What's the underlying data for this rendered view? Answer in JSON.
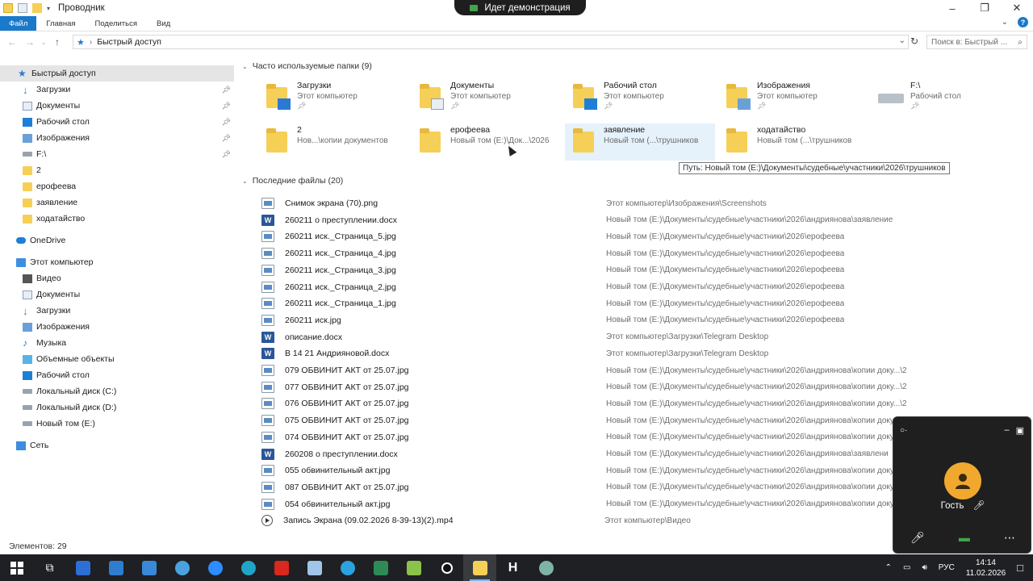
{
  "window": {
    "title": "Проводник",
    "demo_banner": "Идет демонстрация"
  },
  "ribbon": {
    "tabs": [
      "Файл",
      "Главная",
      "Поделиться",
      "Вид"
    ]
  },
  "address": {
    "path": "Быстрый доступ",
    "search_placeholder": "Поиск в: Быстрый ..."
  },
  "sidebar": {
    "quick_access": "Быстрый доступ",
    "pinned": [
      {
        "label": "Загрузки",
        "icon": "download-icon",
        "pinned": true
      },
      {
        "label": "Документы",
        "icon": "documents-icon",
        "pinned": true
      },
      {
        "label": "Рабочий стол",
        "icon": "desktop-icon",
        "pinned": true
      },
      {
        "label": "Изображения",
        "icon": "pictures-icon",
        "pinned": true
      },
      {
        "label": "F:\\",
        "icon": "drive-icon",
        "pinned": true
      },
      {
        "label": "2",
        "icon": "folder-icon",
        "pinned": false
      },
      {
        "label": "ерофеева",
        "icon": "folder-icon",
        "pinned": false
      },
      {
        "label": "заявление",
        "icon": "folder-icon",
        "pinned": false
      },
      {
        "label": "ходатайство",
        "icon": "folder-icon",
        "pinned": false
      }
    ],
    "onedrive": "OneDrive",
    "this_pc": "Этот компьютер",
    "pc_items": [
      {
        "label": "Видео",
        "icon": "video-icon"
      },
      {
        "label": "Документы",
        "icon": "documents-icon"
      },
      {
        "label": "Загрузки",
        "icon": "download-icon"
      },
      {
        "label": "Изображения",
        "icon": "pictures-icon"
      },
      {
        "label": "Музыка",
        "icon": "music-icon"
      },
      {
        "label": "Объемные объекты",
        "icon": "3d-objects-icon"
      },
      {
        "label": "Рабочий стол",
        "icon": "desktop-icon"
      },
      {
        "label": "Локальный диск (C:)",
        "icon": "drive-icon"
      },
      {
        "label": "Локальный диск (D:)",
        "icon": "drive-icon"
      },
      {
        "label": "Новый том (E:)",
        "icon": "drive-icon"
      }
    ],
    "network": "Сеть"
  },
  "status": "Элементов: 29",
  "frequent": {
    "header": "Часто используемые папки (9)",
    "items": [
      {
        "name": "Загрузки",
        "sub": "Этот компьютер",
        "pinned": true,
        "badge": "download"
      },
      {
        "name": "Документы",
        "sub": "Этот компьютер",
        "pinned": true,
        "badge": "doc"
      },
      {
        "name": "Рабочий стол",
        "sub": "Этот компьютер",
        "pinned": true,
        "badge": "desktop"
      },
      {
        "name": "Изображения",
        "sub": "Этот компьютер",
        "pinned": true,
        "badge": "pictures"
      },
      {
        "name": "F:\\",
        "sub": "Рабочий стол",
        "pinned": true,
        "badge": "drive"
      },
      {
        "name": "2",
        "sub": "Нов...\\копии документов",
        "pinned": false,
        "badge": ""
      },
      {
        "name": "ерофеева",
        "sub": "Новый том (E:)\\Док...\\2026",
        "pinned": false,
        "badge": ""
      },
      {
        "name": "заявление",
        "sub": "Новый том (...\\трушников",
        "pinned": false,
        "badge": ""
      },
      {
        "name": "ходатайство",
        "sub": "Новый том (...\\трушников",
        "pinned": false,
        "badge": ""
      }
    ],
    "tooltip": "Путь: Новый том (E:)\\Документы\\судебные\\участники\\2026\\трушников"
  },
  "recent": {
    "header": "Последние файлы (20)",
    "files": [
      {
        "name": "Снимок экрана (70).png",
        "path": "Этот компьютер\\Изображения\\Screenshots",
        "type": "img"
      },
      {
        "name": "260211 о преступлении.docx",
        "path": "Новый том (E:)\\Документы\\судебные\\участники\\2026\\андриянова\\заявление",
        "type": "word"
      },
      {
        "name": "260211 иск._Страница_5.jpg",
        "path": "Новый том (E:)\\Документы\\судебные\\участники\\2026\\ерофеева",
        "type": "img"
      },
      {
        "name": "260211 иск._Страница_4.jpg",
        "path": "Новый том (E:)\\Документы\\судебные\\участники\\2026\\ерофеева",
        "type": "img"
      },
      {
        "name": "260211 иск._Страница_3.jpg",
        "path": "Новый том (E:)\\Документы\\судебные\\участники\\2026\\ерофеева",
        "type": "img"
      },
      {
        "name": "260211 иск._Страница_2.jpg",
        "path": "Новый том (E:)\\Документы\\судебные\\участники\\2026\\ерофеева",
        "type": "img"
      },
      {
        "name": "260211 иск._Страница_1.jpg",
        "path": "Новый том (E:)\\Документы\\судебные\\участники\\2026\\ерофеева",
        "type": "img"
      },
      {
        "name": "260211 иск.jpg",
        "path": "Новый том (E:)\\Документы\\судебные\\участники\\2026\\ерофеева",
        "type": "img"
      },
      {
        "name": "описание.docx",
        "path": "Этот компьютер\\Загрузки\\Telegram Desktop",
        "type": "word"
      },
      {
        "name": "В 14 21 Андрияновой.docx",
        "path": "Этот компьютер\\Загрузки\\Telegram Desktop",
        "type": "word"
      },
      {
        "name": "079 ОБВИНИТ АКТ от 25.07.jpg",
        "path": "Новый том (E:)\\Документы\\судебные\\участники\\2026\\андриянова\\копии доку...\\2",
        "type": "img"
      },
      {
        "name": "077 ОБВИНИТ АКТ от 25.07.jpg",
        "path": "Новый том (E:)\\Документы\\судебные\\участники\\2026\\андриянова\\копии доку...\\2",
        "type": "img"
      },
      {
        "name": "076 ОБВИНИТ АКТ от 25.07.jpg",
        "path": "Новый том (E:)\\Документы\\судебные\\участники\\2026\\андриянова\\копии доку...\\2",
        "type": "img"
      },
      {
        "name": "075 ОБВИНИТ АКТ от 25.07.jpg",
        "path": "Новый том (E:)\\Документы\\судебные\\участники\\2026\\андриянова\\копии доку",
        "type": "img"
      },
      {
        "name": "074 ОБВИНИТ АКТ от 25.07.jpg",
        "path": "Новый том (E:)\\Документы\\судебные\\участники\\2026\\андриянова\\копии доку",
        "type": "img"
      },
      {
        "name": "260208 о преступлении.docx",
        "path": "Новый том (E:)\\Документы\\судебные\\участники\\2026\\андриянова\\заявлени",
        "type": "word"
      },
      {
        "name": "055 обвинительный акт.jpg",
        "path": "Новый том (E:)\\Документы\\судебные\\участники\\2026\\андриянова\\копии доку",
        "type": "img"
      },
      {
        "name": "087 ОБВИНИТ АКТ от 25.07.jpg",
        "path": "Новый том (E:)\\Документы\\судебные\\участники\\2026\\андриянова\\копии доку",
        "type": "img"
      },
      {
        "name": "054 обвинительный акт.jpg",
        "path": "Новый том (E:)\\Документы\\судебные\\участники\\2026\\андриянова\\копии доку",
        "type": "img"
      },
      {
        "name": "Запись Экрана (09.02.2026 8-39-13)(2).mp4",
        "path": "Этот компьютер\\Видео",
        "type": "video"
      }
    ]
  },
  "call": {
    "user": "Гость"
  },
  "taskbar": {
    "lang": "РУС",
    "time": "14:14",
    "date": "11.02.2026"
  },
  "colors": {
    "accent": "#1979ca",
    "folder": "#f6cf57",
    "taskbar": "#1f2023"
  }
}
